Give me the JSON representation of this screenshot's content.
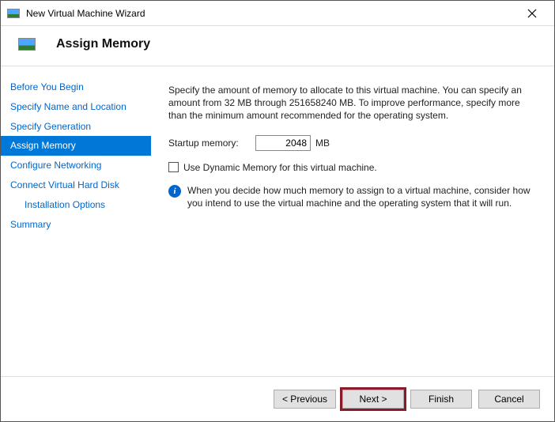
{
  "window": {
    "title": "New Virtual Machine Wizard"
  },
  "header": {
    "title": "Assign Memory"
  },
  "sidebar": {
    "items": [
      {
        "label": "Before You Begin"
      },
      {
        "label": "Specify Name and Location"
      },
      {
        "label": "Specify Generation"
      },
      {
        "label": "Assign Memory"
      },
      {
        "label": "Configure Networking"
      },
      {
        "label": "Connect Virtual Hard Disk"
      },
      {
        "label": "Installation Options"
      },
      {
        "label": "Summary"
      }
    ]
  },
  "content": {
    "description": "Specify the amount of memory to allocate to this virtual machine. You can specify an amount from 32 MB through 251658240 MB. To improve performance, specify more than the minimum amount recommended for the operating system.",
    "startup_label": "Startup memory:",
    "startup_value": "2048",
    "startup_unit": "MB",
    "dynamic_label": "Use Dynamic Memory for this virtual machine.",
    "info": "When you decide how much memory to assign to a virtual machine, consider how you intend to use the virtual machine and the operating system that it will run."
  },
  "footer": {
    "previous": "< Previous",
    "next": "Next >",
    "finish": "Finish",
    "cancel": "Cancel"
  }
}
